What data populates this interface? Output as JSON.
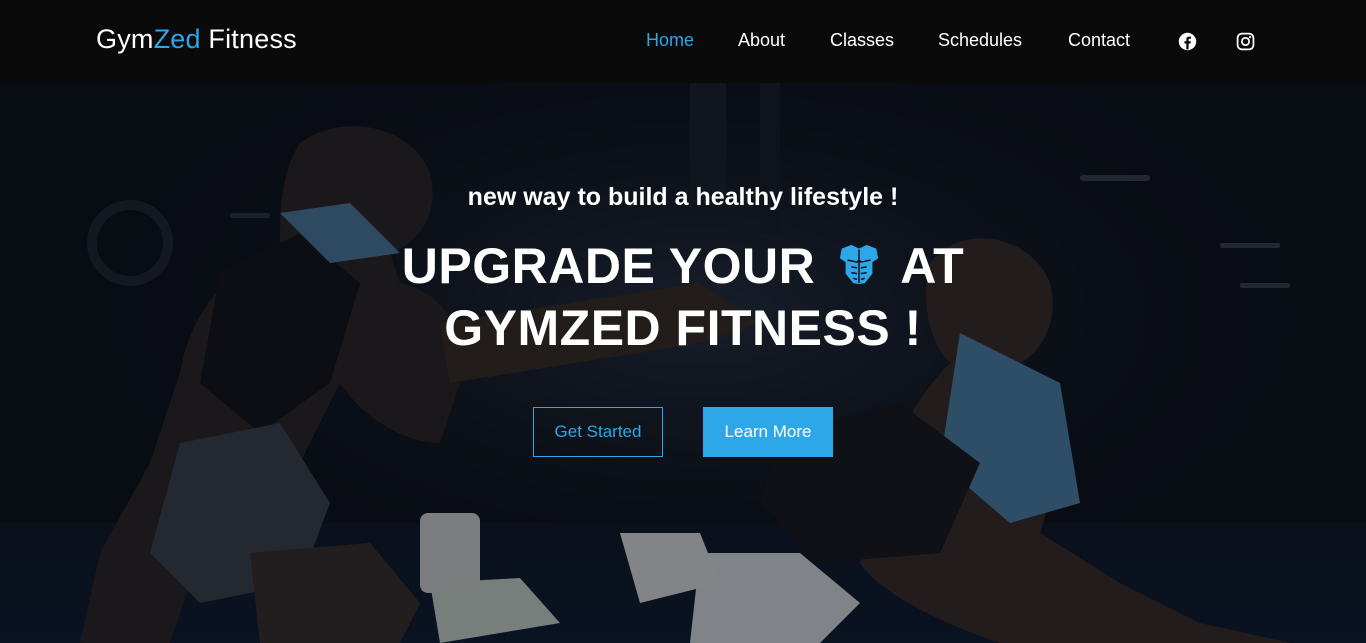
{
  "navbar": {
    "brand": {
      "part1": "Gym",
      "accent": "Zed",
      "part2": " Fitness"
    },
    "links": [
      {
        "label": "Home",
        "active": true
      },
      {
        "label": "About",
        "active": false
      },
      {
        "label": "Classes",
        "active": false
      },
      {
        "label": "Schedules",
        "active": false
      },
      {
        "label": "Contact",
        "active": false
      }
    ],
    "social": [
      "facebook-icon",
      "instagram-icon"
    ]
  },
  "hero": {
    "tagline": "new way to build a healthy lifestyle !",
    "headline_line1_pre": "UPGRADE YOUR",
    "headline_icon": "muscle-torso-icon",
    "headline_line1_post": "AT",
    "headline_line2": "GYMZED FITNESS !",
    "buttons": {
      "primary": "Get Started",
      "secondary": "Learn More"
    }
  },
  "colors": {
    "accent": "#2ea7e8",
    "navbar_bg": "#0a0a0b",
    "text": "#ffffff"
  }
}
